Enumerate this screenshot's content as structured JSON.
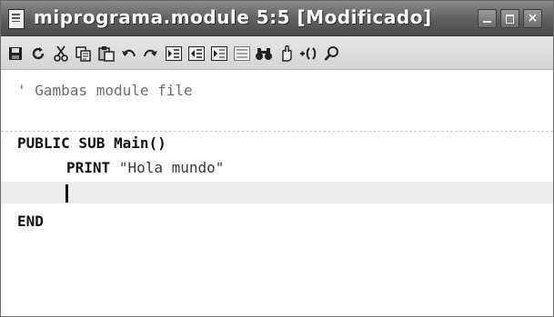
{
  "window": {
    "title": "miprograma.module 5:5 [Modificado]"
  },
  "window_controls": {
    "minimize_icon": "minimize-icon",
    "maximize_icon": "maximize-icon",
    "close_glyph": "×"
  },
  "toolbar": {
    "items": [
      {
        "name": "save",
        "icon": "floppy-disk-icon"
      },
      {
        "name": "reload",
        "icon": "reload-icon"
      },
      {
        "name": "cut",
        "icon": "scissors-icon"
      },
      {
        "name": "copy",
        "icon": "copy-icon"
      },
      {
        "name": "paste",
        "icon": "paste-icon"
      },
      {
        "name": "undo",
        "icon": "undo-icon"
      },
      {
        "name": "redo",
        "icon": "redo-icon"
      },
      {
        "name": "indent",
        "icon": "indent-icon"
      },
      {
        "name": "unindent",
        "icon": "unindent-icon"
      },
      {
        "name": "comment",
        "icon": "comment-icon"
      },
      {
        "name": "uncomment",
        "icon": "uncomment-icon"
      },
      {
        "name": "highlight",
        "icon": "highlight-icon"
      },
      {
        "name": "find",
        "icon": "binoculars-icon"
      },
      {
        "name": "clear",
        "icon": "hand-icon"
      },
      {
        "name": "watch",
        "icon": "watch-icon"
      },
      {
        "name": "search",
        "icon": "magnifier-icon"
      }
    ]
  },
  "editor": {
    "comment_line": "' Gambas module file",
    "line_public_sub_kw": "PUBLIC SUB",
    "line_public_sub_rest": " Main()",
    "line_print_kw": "PRINT",
    "line_print_string": "\"Hola mundo\"",
    "line_end": "END"
  }
}
